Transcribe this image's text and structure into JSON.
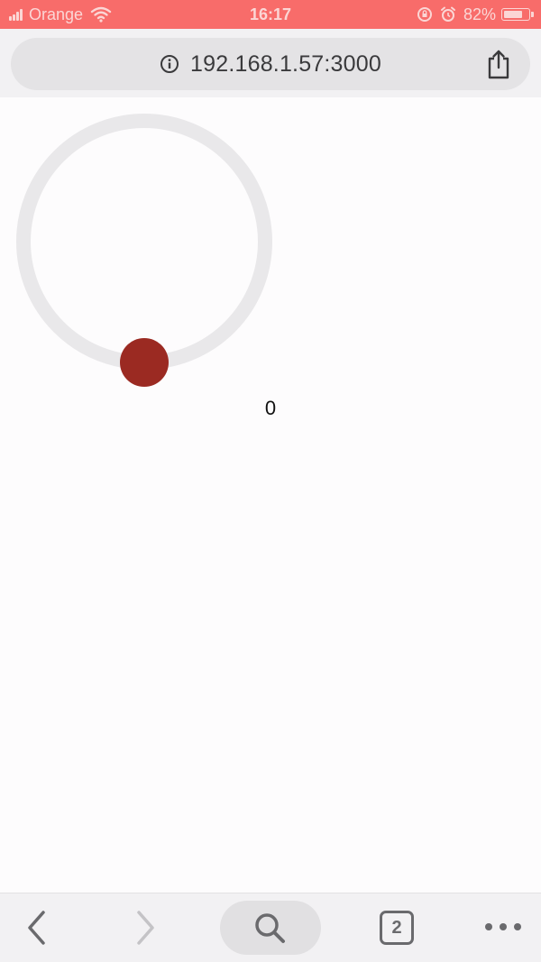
{
  "status_bar": {
    "carrier": "Orange",
    "time": "16:17",
    "battery_percent": "82%",
    "battery_level": 0.82,
    "background": "#f86c6a"
  },
  "address_bar": {
    "url": "192.168.1.57:3000",
    "info_icon": "info-icon",
    "share_icon": "share-icon"
  },
  "dial": {
    "value": "0",
    "ring_color": "#e9e8ea",
    "knob_color": "#9b2a22"
  },
  "toolbar": {
    "back_icon": "chevron-left-icon",
    "forward_icon": "chevron-right-icon",
    "search_icon": "search-icon",
    "tab_count": "2",
    "more_icon": "more-icon"
  }
}
